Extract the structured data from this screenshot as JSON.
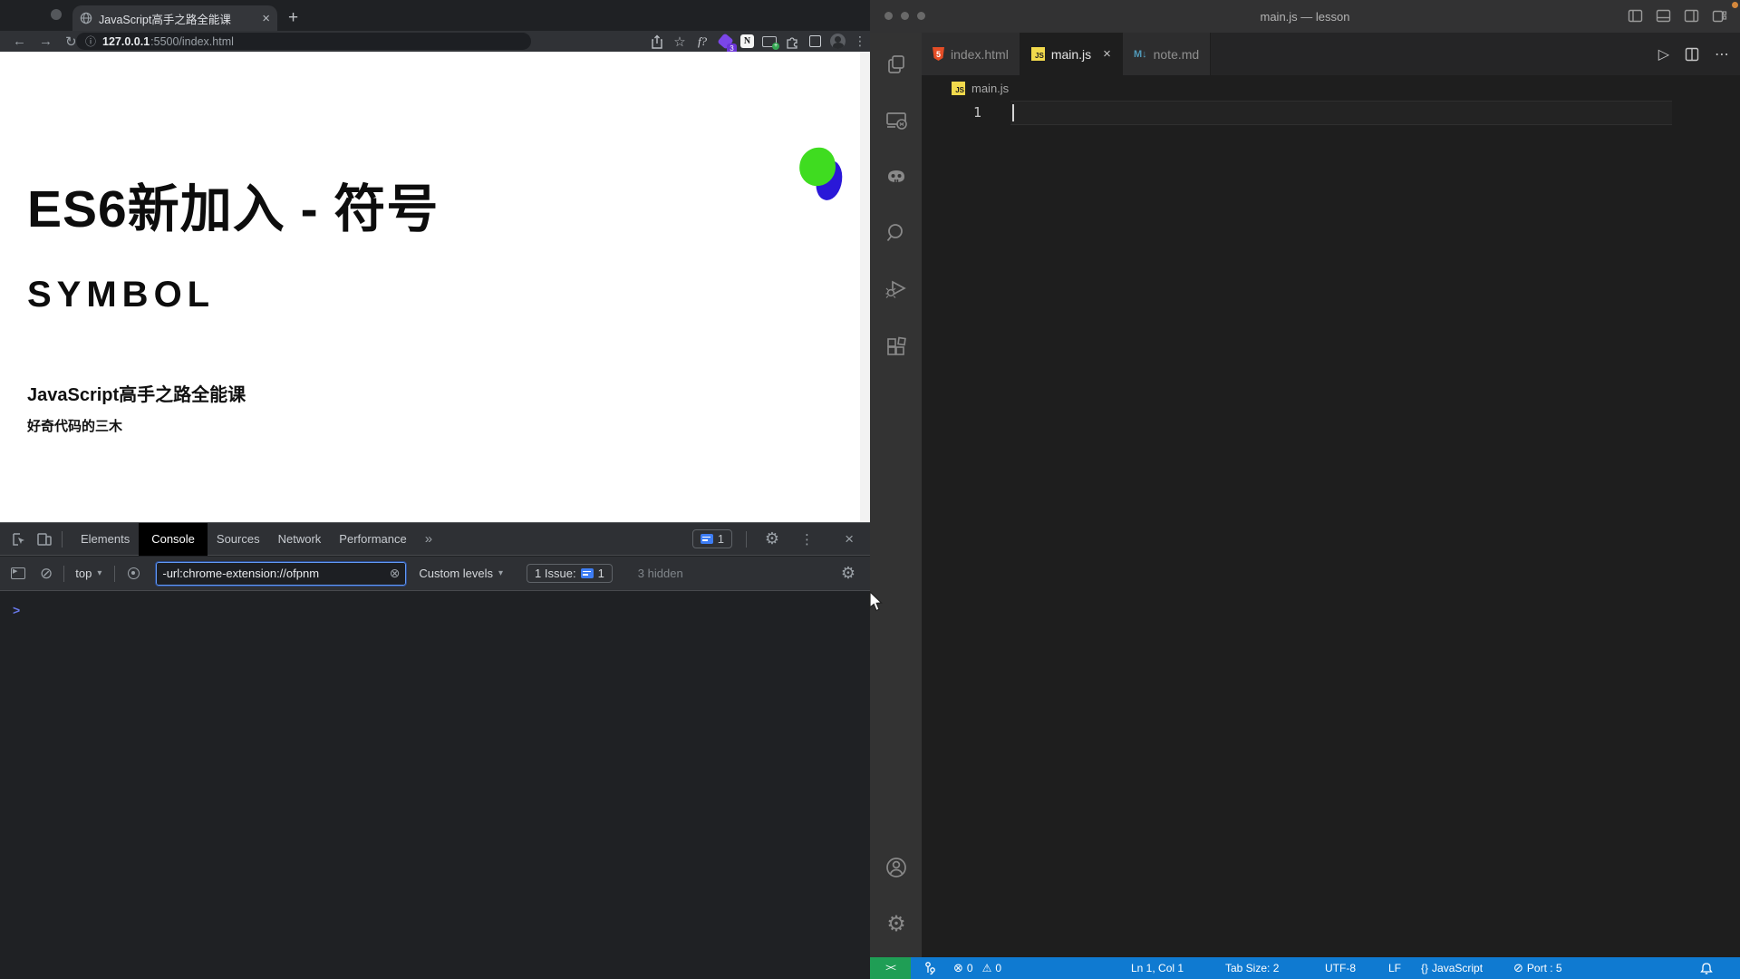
{
  "browser": {
    "tab_title": "JavaScript高手之路全能课",
    "url_host": "127.0.0.1",
    "url_rest": ":5500/index.html",
    "extension_badge": "3",
    "extension_n": "N",
    "extension_fq": "f?",
    "page": {
      "heading": "ES6新加入 - 符号",
      "subheading": "SYMBOL",
      "course_title": "JavaScript高手之路全能课",
      "author": "好奇代码的三木"
    },
    "devtools": {
      "tabs": [
        "Elements",
        "Console",
        "Sources",
        "Network",
        "Performance"
      ],
      "more_tabs": "»",
      "issues_count": "1",
      "context_selector": "top",
      "filter_value": "-url:chrome-extension://ofpnm",
      "levels_label": "Custom levels",
      "issue_chip_label": "1 Issue:",
      "issue_chip_count": "1",
      "hidden_label": "3 hidden"
    }
  },
  "vscode": {
    "window_title": "main.js — lesson",
    "tabs": [
      {
        "label": "index.html",
        "badge": "5"
      },
      {
        "label": "main.js",
        "badge": "JS"
      },
      {
        "label": "note.md",
        "badge": "M↓"
      }
    ],
    "breadcrumb": "main.js",
    "breadcrumb_badge": "JS",
    "editor_line_number": "1",
    "status_bar": {
      "remote_indicator": "><",
      "errors": "0",
      "warnings": "0",
      "cursor_position": "Ln 1, Col 1",
      "tab_size": "Tab Size: 2",
      "encoding": "UTF-8",
      "eol": "LF",
      "language_braces": "{}",
      "language": "JavaScript",
      "port": "Port : 5"
    }
  },
  "glyphs": {
    "close": "×",
    "new_tab": "+",
    "back": "←",
    "forward": "→",
    "reload": "↻",
    "info": "ⓘ",
    "star": "☆",
    "kebab": "⋮",
    "ellipsis": "⋯",
    "dropdown": "▾",
    "ban": "⊘",
    "gear": "⚙",
    "warning": "⚠",
    "error_circle": "⊗",
    "clear_circle": "⊗",
    "prompt": ">",
    "run": "▷"
  },
  "colors": {
    "accent_blue": "#3d7df5",
    "status_bar_blue": "#0f7ad1",
    "remote_green": "#1f9e55",
    "html_icon": "#e44d26",
    "js_icon": "#f2da4c",
    "md_icon": "#519aba",
    "logo_green": "#3fdc20",
    "logo_blue": "#2a18d8"
  }
}
